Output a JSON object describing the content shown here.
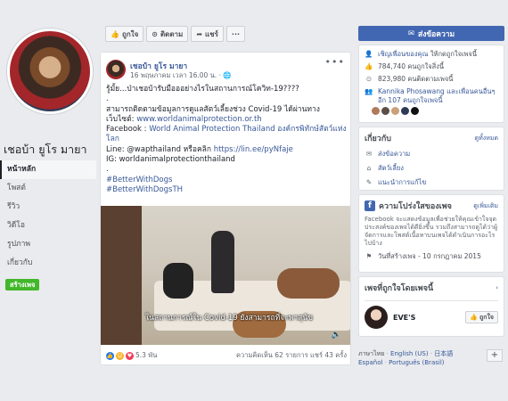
{
  "page": {
    "name": "เชอบ้า ยูโร มายา"
  },
  "left_nav": {
    "items": [
      {
        "label": "หน้าหลัก",
        "active": true
      },
      {
        "label": "โพสต์"
      },
      {
        "label": "รีวิว"
      },
      {
        "label": "วิดีโอ"
      },
      {
        "label": "รูปภาพ"
      },
      {
        "label": "เกี่ยวกับ"
      },
      {
        "label": "ชุมชน"
      }
    ],
    "create_page_label": "สร้างเพจ"
  },
  "actions_bar": {
    "like_label": "ถูกใจ",
    "follow_label": "ติดตาม",
    "share_label": "แชร์",
    "more_label": "···"
  },
  "post": {
    "author": "เชอบ้า ยูโร มายา",
    "time": "16 พฤษภาคม เวลา 16.00 น. · 🌐",
    "menu": "•••",
    "lines": [
      {
        "text": "รู้มั้ย...ป่าเชอบ้ารับมือออย่างไรในสถานการณ์โควิท-19????",
        "link": false
      },
      {
        "text": ".",
        "link": false
      },
      {
        "text": "สามารถติดตามข้อมูลการดูแลสัตว์เลี้ยงช่วง Covid-19 ได้ผ่านทาง",
        "link": false
      },
      {
        "text": "เว็บไซต์: ",
        "link_text": "www.worldanimalprotection.or.th"
      },
      {
        "text": "Facebook : ",
        "link_text": "World Animal Protection Thailand องค์กรพิทักษ์สัตว์แห่ง"
      },
      {
        "text": "",
        "link_text": "โลก"
      },
      {
        "text": "Line: @wapthailand หรือคลิก ",
        "link_text": "https://lin.ee/pyNfaje"
      },
      {
        "text": "IG: worldanimalprotectionthailand",
        "link": false
      },
      {
        "text": ".",
        "link": false
      },
      {
        "text": "",
        "link_text": "#BetterWithDogs"
      },
      {
        "text": "",
        "link_text": "#BetterWithDogsTH"
      }
    ],
    "media_caption": "ในสถานการณ์ใน Covid-19 ยังสามารถที่จะพาสุนัข",
    "media_icon": "🔈",
    "reactions_count": "5.3 พัน",
    "stats": "ความคิดเห็น 62 รายการ  แชร์ 43 ครั้ง"
  },
  "right": {
    "send_message_label": "ส่งข้อความ",
    "invite_friends": "เชิญเพื่อนของคุณ",
    "invite_tail": " ให้กดถูกใจเพจนี้",
    "likes_count": "784,740 คนถูกใจสิ่งนี้",
    "follows_count": "823,980 คนติดตามเพจนี้",
    "friends_like_text": "Kannika Phosawang และเพื่อนคนอื่นๆ อีก 107 คนถูกใจเพจนี้",
    "about_title": "เกี่ยวกับ",
    "about_see_all": "ดูทั้งหมด",
    "about_items": [
      {
        "label": "ส่งข้อความ",
        "icon": "messenger-icon"
      },
      {
        "label": "สัตว์เลี้ยง",
        "icon": "tag-icon"
      },
      {
        "label": "แนะนำการแก้ไข",
        "icon": "pencil-icon"
      }
    ],
    "transparency_title": "ความโปร่งใสของเพจ",
    "transparency_see_more": "ดูเพิ่มเติม",
    "transparency_desc": "Facebook จะแสดงข้อมูลเพื่อช่วยให้คุณเข้าใจจุดประสงค์ของเพจได้ดียิ่งขึ้น รวมถึงสามารถดูได้ว่าผู้จัดการและโพสต์เนื้อหาบนเพจได้ดำเนินการอะไรไปบ้าง",
    "created_date": "วันที่สร้างเพจ - 10 กรกฎาคม 2015",
    "liked_pages_title": "เพจที่ถูกใจโดยเพจนี้",
    "liked_page_name": "EVE'S",
    "liked_page_like_label": "ถูกใจ",
    "languages_current": "ภาษาไทย",
    "languages": [
      "English (US)",
      "日本語",
      "Español",
      "Português (Brasil)"
    ],
    "languages_plus": "+"
  }
}
